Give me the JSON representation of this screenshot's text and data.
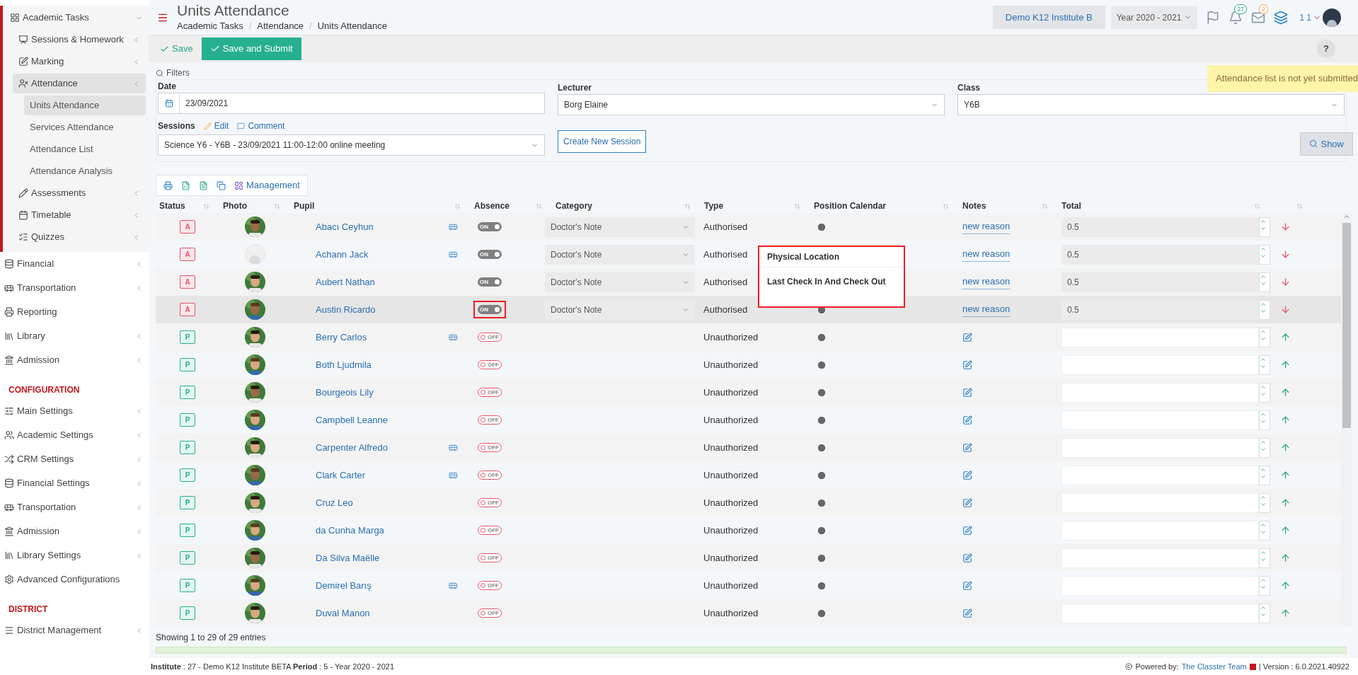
{
  "sidebar": {
    "items": [
      {
        "kind": "group",
        "label": "Academic Tasks",
        "expanded": true
      },
      {
        "kind": "item",
        "label": "Sessions & Homework",
        "selected": false
      },
      {
        "kind": "item",
        "label": "Marking",
        "selected": false
      },
      {
        "kind": "item",
        "label": "Attendance",
        "selected": true
      },
      {
        "kind": "sub",
        "label": "Units Attendance",
        "selected": true
      },
      {
        "kind": "sub",
        "label": "Services Attendance",
        "selected": false
      },
      {
        "kind": "sub",
        "label": "Attendance List",
        "selected": false
      },
      {
        "kind": "sub",
        "label": "Attendance Analysis",
        "selected": false
      },
      {
        "kind": "item",
        "label": "Assessments",
        "selected": false
      },
      {
        "kind": "item",
        "label": "Timetable",
        "selected": false
      },
      {
        "kind": "item",
        "label": "Quizzes",
        "selected": false
      },
      {
        "kind": "top",
        "label": "Financial",
        "selected": false
      },
      {
        "kind": "top",
        "label": "Transportation",
        "selected": false
      },
      {
        "kind": "top",
        "label": "Reporting",
        "selected": false
      },
      {
        "kind": "top",
        "label": "Library",
        "selected": false
      },
      {
        "kind": "top",
        "label": "Admission",
        "selected": false
      },
      {
        "kind": "heading",
        "label": "CONFIGURATION"
      },
      {
        "kind": "top",
        "label": "Main Settings",
        "selected": false
      },
      {
        "kind": "top",
        "label": "Academic Settings",
        "selected": false
      },
      {
        "kind": "top",
        "label": "CRM Settings",
        "selected": false
      },
      {
        "kind": "top",
        "label": "Financial Settings",
        "selected": false
      },
      {
        "kind": "top",
        "label": "Transportation",
        "selected": false
      },
      {
        "kind": "top",
        "label": "Admission",
        "selected": false
      },
      {
        "kind": "top",
        "label": "Library Settings",
        "selected": false
      },
      {
        "kind": "top",
        "label": "Advanced Configurations",
        "selected": false
      },
      {
        "kind": "heading",
        "label": "DISTRICT"
      },
      {
        "kind": "top",
        "label": "District Management",
        "selected": false
      }
    ]
  },
  "header": {
    "title": "Units Attendance",
    "breadcrumb": [
      {
        "kind": "link",
        "text": "Academic Tasks"
      },
      {
        "kind": "separator",
        "text": "/"
      },
      {
        "kind": "link",
        "text": "Attendance"
      },
      {
        "kind": "separator",
        "text": "/"
      },
      {
        "kind": "link",
        "text": "Units Attendance"
      }
    ],
    "institute": "Demo K12 Institute B",
    "year": "Year 2020 - 2021",
    "notifications": "27",
    "messages": "2",
    "user": "1 1"
  },
  "toolbar": {
    "save": "Save",
    "save_submit": "Save and Submit",
    "help": "?"
  },
  "alert": "Attendance list is not yet submitted",
  "filters": {
    "title": "Filters",
    "date_label": "Date",
    "date": "23/09/2021",
    "lecturer_label": "Lecturer",
    "lecturer": "Borg Elaine",
    "class_label": "Class",
    "class": "Y6B",
    "sessions_label": "Sessions",
    "edit": "Edit",
    "comment": "Comment",
    "session": "Science Y6 - Y6B - 23/09/2021 11:00-12:00 online meeting",
    "create": "Create New Session",
    "show": "Show"
  },
  "table_tools": {
    "management": "Management"
  },
  "table": {
    "columns": [
      "Status",
      "Photo",
      "Pupil",
      "Absence",
      "Category",
      "Type",
      "Position Calendar",
      "Notes",
      "Total"
    ],
    "rows": [
      {
        "status": "A",
        "has_photo": true,
        "name": "Abacı Ceyhun",
        "bus": true,
        "absence": "ON",
        "absent": true,
        "category": "Doctor's Note",
        "type": "Authorised",
        "note": "new reason",
        "total": "0.5",
        "selected": false,
        "highlighted": false
      },
      {
        "status": "A",
        "has_photo": false,
        "name": "Achann Jack",
        "bus": true,
        "absence": "ON",
        "absent": true,
        "category": "Doctor's Note",
        "type": "Authorised",
        "note": "new reason",
        "total": "0.5",
        "selected": false,
        "highlighted": false
      },
      {
        "status": "A",
        "has_photo": true,
        "name": "Aubert Nathan",
        "bus": false,
        "absence": "ON",
        "absent": true,
        "category": "Doctor's Note",
        "type": "Authorised",
        "note": "new reason",
        "total": "0.5",
        "selected": false,
        "highlighted": false
      },
      {
        "status": "A",
        "has_photo": true,
        "name": "Austin Ricardo",
        "bus": false,
        "absence": "ON",
        "absent": true,
        "category": "Doctor's Note",
        "type": "Authorised",
        "note": "new reason",
        "total": "0.5",
        "selected": true,
        "highlighted": true
      },
      {
        "status": "P",
        "has_photo": true,
        "name": "Berry Carlos",
        "bus": true,
        "absence": "OFF",
        "absent": false,
        "type": "Unauthorized",
        "selected": false,
        "highlighted": false
      },
      {
        "status": "P",
        "has_photo": true,
        "name": "Both Ljudmila",
        "bus": false,
        "absence": "OFF",
        "absent": false,
        "type": "Unauthorized",
        "selected": false,
        "highlighted": false
      },
      {
        "status": "P",
        "has_photo": true,
        "name": "Bourgeois Lily",
        "bus": false,
        "absence": "OFF",
        "absent": false,
        "type": "Unauthorized",
        "selected": false,
        "highlighted": false
      },
      {
        "status": "P",
        "has_photo": true,
        "name": "Campbell Leanne",
        "bus": false,
        "absence": "OFF",
        "absent": false,
        "type": "Unauthorized",
        "selected": false,
        "highlighted": false
      },
      {
        "status": "P",
        "has_photo": true,
        "name": "Carpenter Alfredo",
        "bus": true,
        "absence": "OFF",
        "absent": false,
        "type": "Unauthorized",
        "selected": false,
        "highlighted": false
      },
      {
        "status": "P",
        "has_photo": true,
        "name": "Clark Carter",
        "bus": true,
        "absence": "OFF",
        "absent": false,
        "type": "Unauthorized",
        "selected": false,
        "highlighted": false
      },
      {
        "status": "P",
        "has_photo": true,
        "name": "Cruz Leo",
        "bus": false,
        "absence": "OFF",
        "absent": false,
        "type": "Unauthorized",
        "selected": false,
        "highlighted": false
      },
      {
        "status": "P",
        "has_photo": true,
        "name": "da Cunha Marga",
        "bus": false,
        "absence": "OFF",
        "absent": false,
        "type": "Unauthorized",
        "selected": false,
        "highlighted": false
      },
      {
        "status": "P",
        "has_photo": true,
        "name": "Da Silva Maëlle",
        "bus": false,
        "absence": "OFF",
        "absent": false,
        "type": "Unauthorized",
        "selected": false,
        "highlighted": false
      },
      {
        "status": "P",
        "has_photo": true,
        "name": "Demirel Barış",
        "bus": true,
        "absence": "OFF",
        "absent": false,
        "type": "Unauthorized",
        "selected": false,
        "highlighted": false
      },
      {
        "status": "P",
        "has_photo": true,
        "name": "Duval Manon",
        "bus": false,
        "absence": "OFF",
        "absent": false,
        "type": "Unauthorized",
        "selected": false,
        "highlighted": false
      }
    ]
  },
  "popover": {
    "items": [
      "Physical Location",
      "Last Check In And Check Out"
    ]
  },
  "entries": "Showing 1 to 29 of 29 entries",
  "footer": {
    "institute_label": "Institute",
    "institute": " : 27 - Demo K12 Institute BETA ",
    "period_label": "Period",
    "period": " : 5 - Year 2020 - 2021",
    "powered": "Powered by:",
    "team": "The Classter Team",
    "version": "| Version : 6.0.2021.40922"
  }
}
